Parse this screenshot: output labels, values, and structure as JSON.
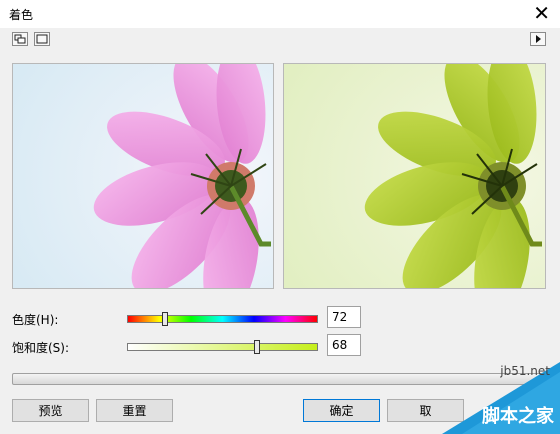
{
  "dialog": {
    "title": "着色",
    "close_glyph": "✕"
  },
  "toolbar": {
    "icons": [
      "dual-preview-icon",
      "single-preview-icon",
      "expand-arrow-icon"
    ]
  },
  "sliders": {
    "hue": {
      "label": "色度(H):",
      "value": "72",
      "level": 0.2
    },
    "saturation": {
      "label": "饱和度(S):",
      "value": "68",
      "level": 0.68
    }
  },
  "buttons": {
    "preview": "预览",
    "reset": "重置",
    "ok": "确定",
    "cancel": "取"
  },
  "watermark": {
    "url": "jb51.net",
    "text": "脚本之家"
  },
  "colors": {
    "accent_blue": "#0078d7",
    "original_pink": "#e88ad6",
    "tinted_green": "#a8c81a"
  }
}
